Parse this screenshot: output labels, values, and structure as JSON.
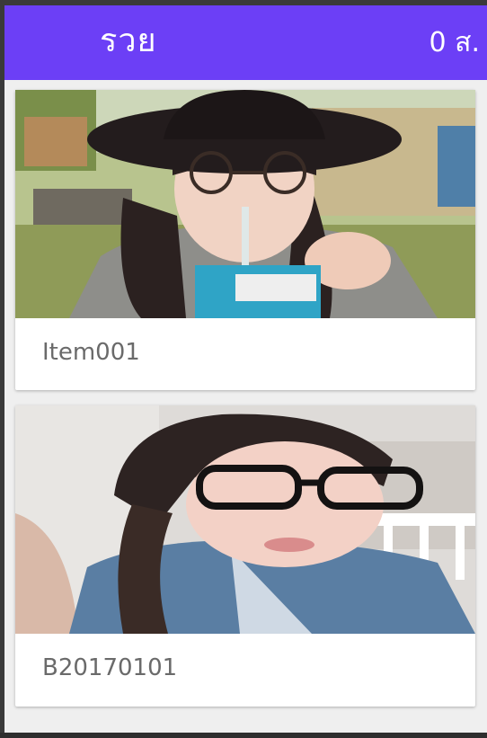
{
  "appbar": {
    "title": "รวย",
    "status": "0 ส.",
    "color": "#6c3ff6"
  },
  "cards": [
    {
      "label": "Item001",
      "photo_icon": "portrait-photo-hat-glasses"
    },
    {
      "label": "B20170101",
      "photo_icon": "portrait-photo-glasses-braid"
    }
  ]
}
